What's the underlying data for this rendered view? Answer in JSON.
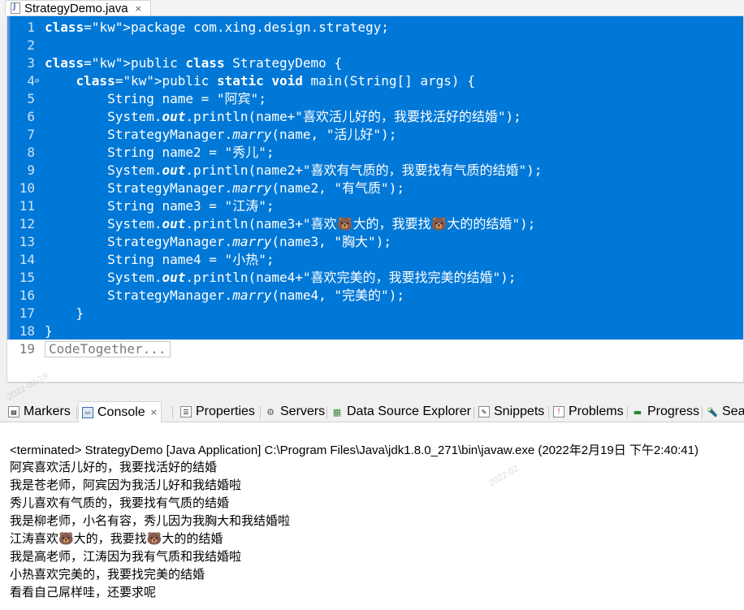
{
  "editor": {
    "tab_title": "StrategyDemo.java",
    "tab_close": "×",
    "lines": [
      {
        "n": "1",
        "text": "package com.xing.design.strategy;",
        "selected": true
      },
      {
        "n": "2",
        "text": "",
        "selected": true
      },
      {
        "n": "3",
        "text": "public class StrategyDemo {",
        "selected": true
      },
      {
        "n": "4",
        "text": "    public static void main(String[] args) {",
        "selected": true,
        "fold": "⊖"
      },
      {
        "n": "5",
        "text": "        String name = \"阿宾\";",
        "selected": true
      },
      {
        "n": "6",
        "text": "        System.out.println(name+\"喜欢活儿好的，我要找活好的结婚\");",
        "selected": true
      },
      {
        "n": "7",
        "text": "        StrategyManager.marry(name, \"活儿好\");",
        "selected": true
      },
      {
        "n": "8",
        "text": "        String name2 = \"秀儿\";",
        "selected": true
      },
      {
        "n": "9",
        "text": "        System.out.println(name2+\"喜欢有气质的，我要找有气质的结婚\");",
        "selected": true
      },
      {
        "n": "10",
        "text": "        StrategyManager.marry(name2, \"有气质\");",
        "selected": true
      },
      {
        "n": "11",
        "text": "        String name3 = \"江涛\";",
        "selected": true
      },
      {
        "n": "12",
        "text": "        System.out.println(name3+\"喜欢🐻大的，我要找🐻大的的结婚\");",
        "selected": true
      },
      {
        "n": "13",
        "text": "        StrategyManager.marry(name3, \"胸大\");",
        "selected": true
      },
      {
        "n": "14",
        "text": "        String name4 = \"小热\";",
        "selected": true
      },
      {
        "n": "15",
        "text": "        System.out.println(name4+\"喜欢完美的，我要找完美的结婚\");",
        "selected": true
      },
      {
        "n": "16",
        "text": "        StrategyManager.marry(name4, \"完美的\");",
        "selected": true
      },
      {
        "n": "17",
        "text": "    }",
        "selected": true
      },
      {
        "n": "18",
        "text": "}",
        "selected": true
      },
      {
        "n": "19",
        "text": "CodeTogether...",
        "selected": false,
        "hint": true
      }
    ]
  },
  "views": {
    "tabs": [
      {
        "id": "markers",
        "label": "Markers",
        "icon": "markers-icon"
      },
      {
        "id": "console",
        "label": "Console",
        "icon": "console-icon",
        "active": true,
        "close": "×"
      },
      {
        "id": "properties",
        "label": "Properties",
        "icon": "properties-icon"
      },
      {
        "id": "servers",
        "label": "Servers",
        "icon": "servers-icon"
      },
      {
        "id": "datasource",
        "label": "Data Source Explorer",
        "icon": "data-source-icon"
      },
      {
        "id": "snippets",
        "label": "Snippets",
        "icon": "snippets-icon"
      },
      {
        "id": "problems",
        "label": "Problems",
        "icon": "problems-icon"
      },
      {
        "id": "progress",
        "label": "Progress",
        "icon": "progress-icon"
      },
      {
        "id": "search",
        "label": "Sea",
        "icon": "search-icon"
      }
    ]
  },
  "console": {
    "header": "<terminated> StrategyDemo [Java Application] C:\\Program Files\\Java\\jdk1.8.0_271\\bin\\javaw.exe (2022年2月19日 下午2:40:41)",
    "output": [
      "阿宾喜欢活儿好的，我要找活好的结婚",
      "我是苍老师，阿宾因为我活儿好和我结婚啦",
      "秀儿喜欢有气质的，我要找有气质的结婚",
      "我是柳老师，小名有容，秀儿因为我胸大和我结婚啦",
      "江涛喜欢🐻大的，我要找🐻大的的结婚",
      "我是高老师，江涛因为我有气质和我结婚啦",
      "小热喜欢完美的，我要找完美的结婚",
      "看看自己屌样哇，还要求呢"
    ]
  }
}
